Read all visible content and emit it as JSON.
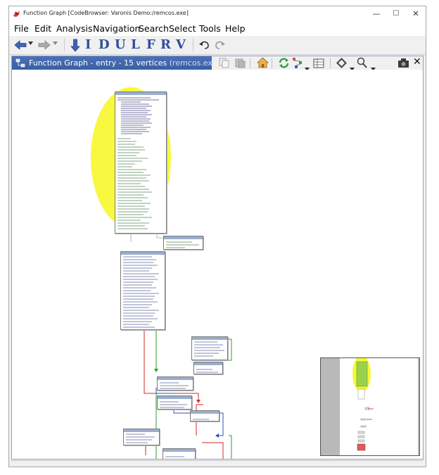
{
  "window": {
    "title": "Function Graph [CodeBrowser: Varonis Demo:/remcos.exe]",
    "controls": {
      "minimize": "—",
      "maximize": "☐",
      "close": "✕"
    }
  },
  "menu": {
    "items": [
      "File",
      "Edit",
      "Analysis",
      "Navigation",
      "Search",
      "Select",
      "Tools",
      "Help"
    ]
  },
  "toolbar": {
    "nav_back_icon": "arrow-left-icon",
    "nav_forward_icon": "arrow-right-icon",
    "letters": [
      "I",
      "D",
      "U",
      "L",
      "F",
      "R",
      "V"
    ],
    "undo_icon": "undo-icon",
    "redo_icon": "redo-icon"
  },
  "panel": {
    "title_prefix": "Function Graph - entry - 15 vertices",
    "title_program": "(remcos.exe)"
  },
  "colors": {
    "panel_title": "#3d62a8",
    "vertex_header": "#9aaecf",
    "highlight": "#f5f500",
    "edge_true": "#2f9e2f",
    "edge_false": "#d42a2a",
    "edge_uncond": "#2b4fc9",
    "selected_vertex": "#e05a5a"
  }
}
